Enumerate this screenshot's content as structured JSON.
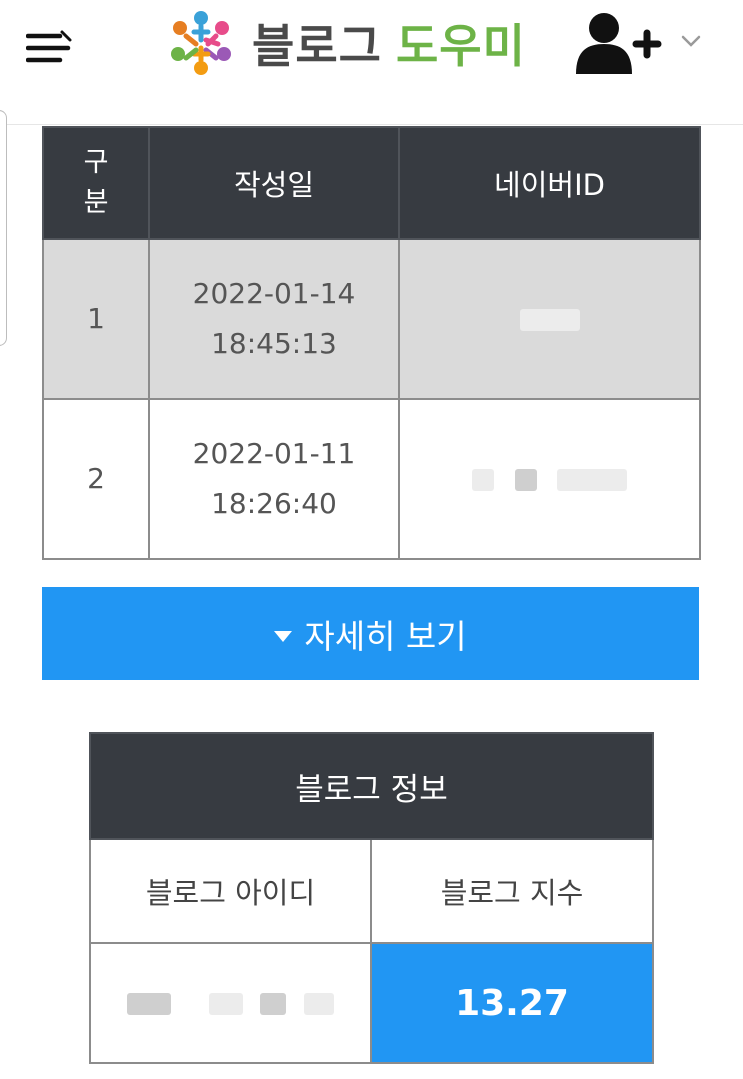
{
  "header": {
    "logo_blog": "블로그",
    "logo_helper": "도우미",
    "icons": {
      "menu": "hamburger-menu-icon",
      "add_user": "user-plus-icon",
      "dropdown": "chevron-down-icon"
    }
  },
  "history_table": {
    "headers": {
      "no": "구분",
      "date": "작성일",
      "naver_id": "네이버ID"
    },
    "rows": [
      {
        "no": "1",
        "date": "2022-01-14",
        "time": "18:45:13"
      },
      {
        "no": "2",
        "date": "2022-01-11",
        "time": "18:26:40"
      }
    ]
  },
  "detail_button": {
    "label": "자세히 보기"
  },
  "blog_info": {
    "title": "블로그 정보",
    "id_label": "블로그 아이디",
    "index_label": "블로그 지수",
    "index_value": "13.27"
  },
  "colors": {
    "accent": "#2196f3",
    "header_dark": "#373b41",
    "logo_green": "#6db347",
    "row_gray": "#dadada"
  }
}
